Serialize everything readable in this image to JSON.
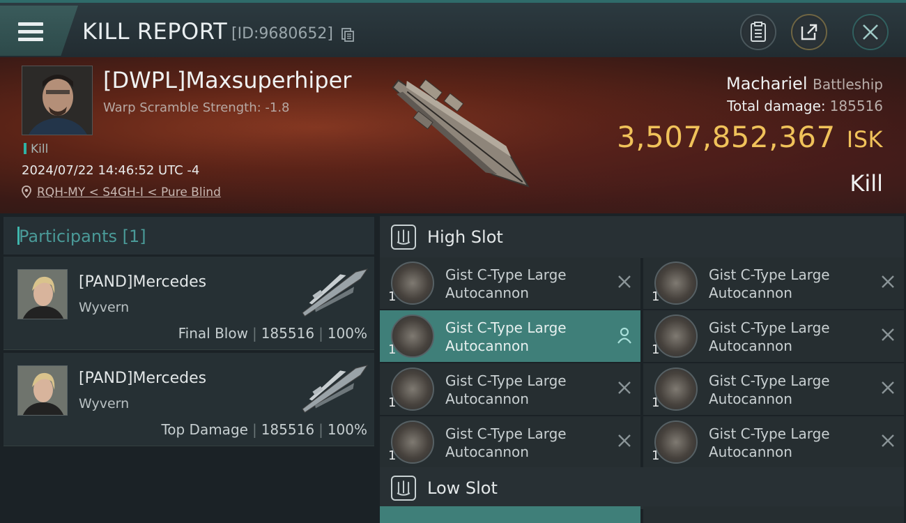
{
  "header": {
    "title": "KILL REPORT",
    "report_id": "[ID:9680652]"
  },
  "victim": {
    "name": "[DWPL]Maxsuperhiper",
    "warp_scramble": "Warp Scramble Strength: -1.8",
    "tag": "Kill",
    "datetime": "2024/07/22 14:46:52 UTC -4",
    "location": "RQH-MY < S4GH-I < Pure Blind",
    "ship_name": "Machariel",
    "ship_class": "Battleship",
    "total_damage_label": "Total damage:",
    "total_damage": "185516",
    "isk_value": "3,507,852,367",
    "isk_unit": "ISK",
    "result": "Kill"
  },
  "participants": {
    "title": "Participants [1]",
    "items": [
      {
        "name": "[PAND]Mercedes",
        "ship": "Wyvern",
        "role": "Final Blow",
        "damage": "185516",
        "percent": "100%"
      },
      {
        "name": "[PAND]Mercedes",
        "ship": "Wyvern",
        "role": "Top Damage",
        "damage": "185516",
        "percent": "100%"
      }
    ]
  },
  "slots": {
    "high_label": "High Slot",
    "low_label": "Low Slot",
    "high_modules": [
      {
        "line1": "Gist C-Type Large",
        "line2": "Autocannon",
        "qty": "1"
      },
      {
        "line1": "Gist C-Type Large",
        "line2": "Autocannon",
        "qty": "1"
      },
      {
        "line1": "Gist C-Type Large",
        "line2": "Autocannon",
        "qty": "1"
      },
      {
        "line1": "Gist C-Type Large",
        "line2": "Autocannon",
        "qty": "1"
      },
      {
        "line1": "Gist C-Type Large",
        "line2": "Autocannon",
        "qty": "1"
      },
      {
        "line1": "Gist C-Type Large",
        "line2": "Autocannon",
        "qty": "1"
      },
      {
        "line1": "Gist C-Type Large",
        "line2": "Autocannon",
        "qty": "1"
      },
      {
        "line1": "Gist C-Type Large",
        "line2": "Autocannon",
        "qty": "1"
      }
    ]
  },
  "colors": {
    "accent_teal": "#3fb7ad",
    "isk_gold": "#f0c25a",
    "active_module": "#3f7f79"
  }
}
